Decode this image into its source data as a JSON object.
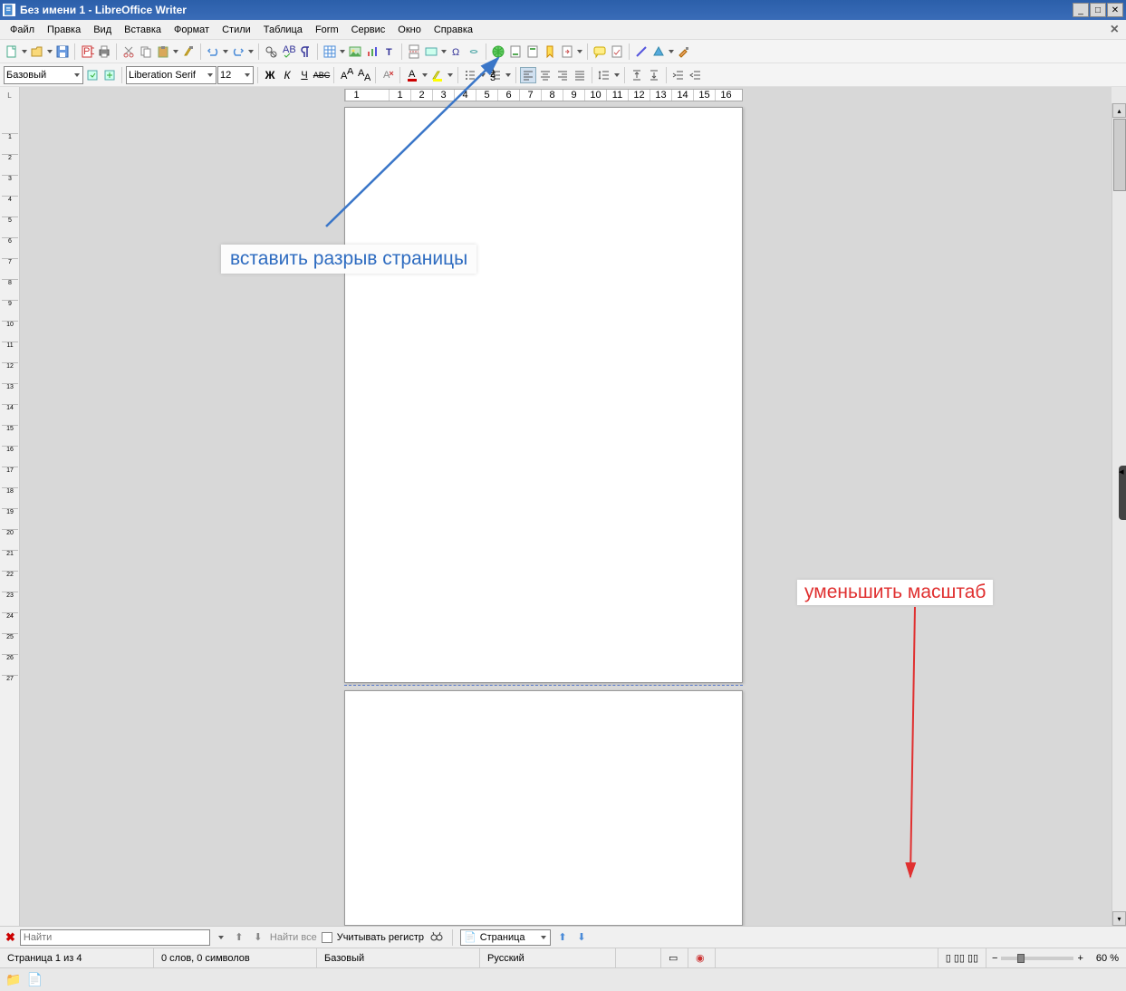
{
  "titlebar": {
    "title": "Без имени 1 - LibreOffice Writer"
  },
  "menu": {
    "file": "Файл",
    "edit": "Правка",
    "view": "Вид",
    "insert": "Вставка",
    "format": "Формат",
    "styles": "Стили",
    "table": "Таблица",
    "form": "Form",
    "tools": "Сервис",
    "window": "Окно",
    "help": "Справка"
  },
  "toolbar2": {
    "para_style": "Базовый",
    "font": "Liberation Serif",
    "size": "12"
  },
  "ruler_corner": "L",
  "ruler_nums": [
    "1",
    "",
    "1",
    "2",
    "3",
    "4",
    "5",
    "6",
    "7",
    "8",
    "9",
    "10",
    "11",
    "12",
    "13",
    "14",
    "15",
    "16",
    "17",
    "18"
  ],
  "findbar": {
    "placeholder": "Найти",
    "findall": "Найти все",
    "matchcase": "Учитывать регистр",
    "style_label": "Страница"
  },
  "status": {
    "page": "Страница 1 из 4",
    "words": "0 слов, 0 символов",
    "style": "Базовый",
    "lang": "Русский",
    "zoom": "60 %"
  },
  "annotations": {
    "a1": "вставить разрыв страницы",
    "a2": "уменьшить масштаб"
  }
}
